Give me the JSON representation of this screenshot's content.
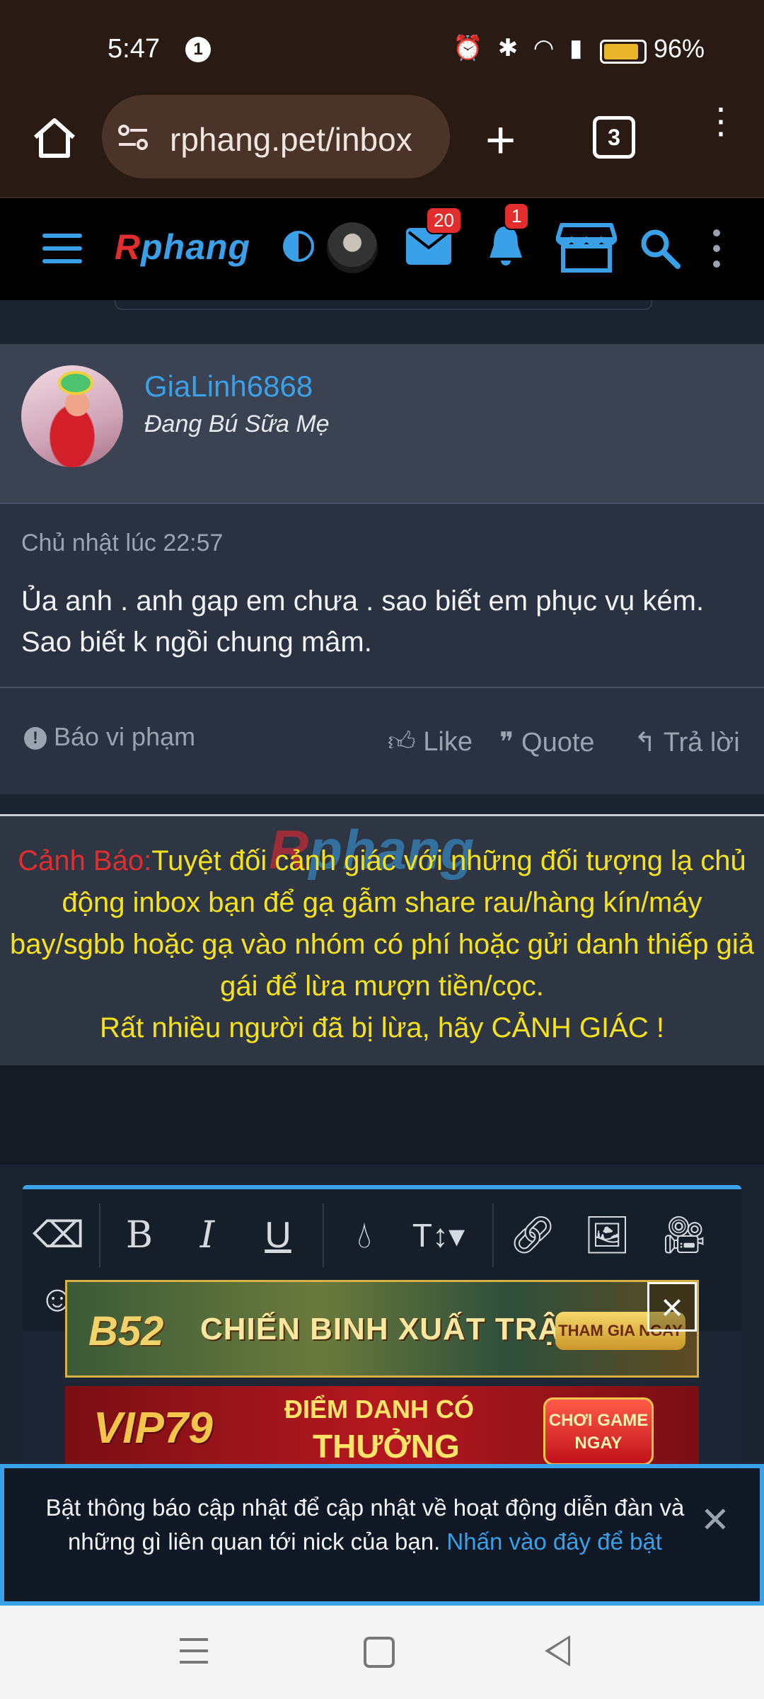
{
  "status_bar": {
    "time": "5:47",
    "notification_count": "1",
    "battery": "96%"
  },
  "browser": {
    "url": "rphang.pet/inbox",
    "tab_count": "3"
  },
  "site_nav": {
    "logo": "Rphang",
    "inbox_badge": "20",
    "alerts_badge": "1",
    "accent_color": "#3aa0e8"
  },
  "message": {
    "username": "GiaLinh6868",
    "user_title": "Đang Bú Sữa Mẹ",
    "date": "Chủ nhật lúc 22:57",
    "body": "Ủa anh . anh gap em chưa . sao biết em phục vụ kém. Sao biết k ngồi chung mâm.",
    "report_label": "Báo vi phạm",
    "like_label": "Like",
    "quote_label": "Quote",
    "reply_label": "Trả lời"
  },
  "warning": {
    "prefix": "Cảnh Báo:",
    "text": "Tuyệt đối cảnh giác với những đối tượng lạ chủ động inbox bạn để gạ gẫm share rau/hàng kín/máy bay/sgbb hoặc gạ vào nhóm có phí hoặc gửi danh thiếp giả gái để lừa mượn tiền/cọc.",
    "line2": "Rất nhiều người đã bị lừa, hãy CẢNH GIÁC !",
    "watermark": "Rphang"
  },
  "ads": {
    "ad1_brand": "B52",
    "ad1_text": "CHIẾN BINH XUẤT TRẬN",
    "ad1_cta": "THAM GIA NGAY",
    "ad2_brand": "VIP79",
    "ad2_line1": "ĐIỂM DANH CÓ",
    "ad2_line2": "THƯỞNG",
    "ad2_cta": "CHƠI GAME NGAY"
  },
  "push_banner": {
    "text": "Bật thông báo cập nhật để cập nhật về hoạt động diễn đàn và những gì liên quan tới nick của bạn.",
    "link": "Nhấn vào đây để bật"
  }
}
